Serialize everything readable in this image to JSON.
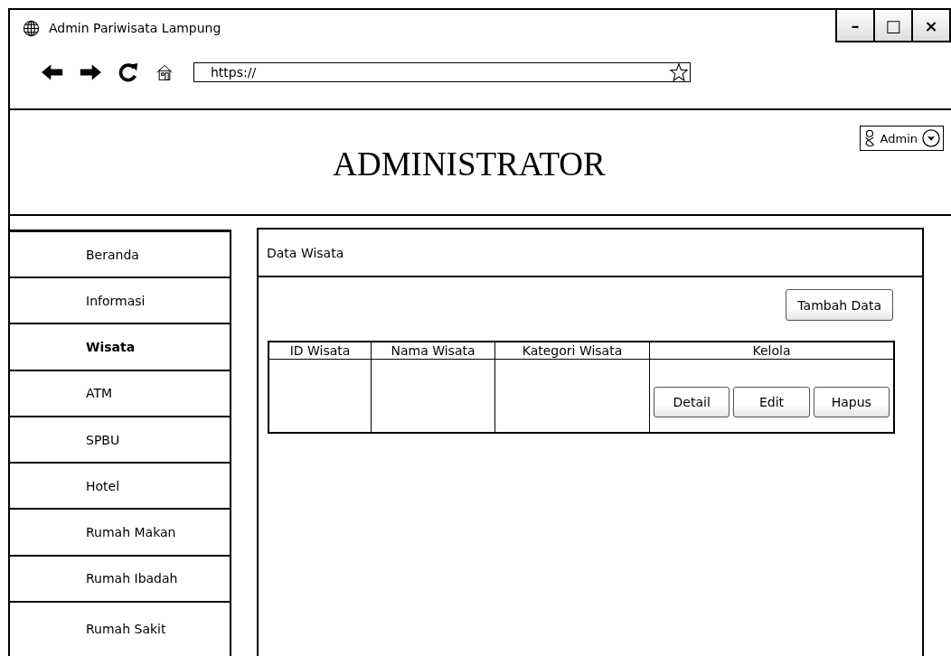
{
  "window": {
    "title": "Admin Pariwisata Lampung",
    "controls": [
      "–",
      "□",
      "×"
    ]
  },
  "browser": {
    "url": "https://"
  },
  "header": {
    "title": "ADMINISTRATOR",
    "user": "Admin"
  },
  "sidebar": {
    "items": [
      {
        "label": "Beranda",
        "selected": false
      },
      {
        "label": "Informasi",
        "selected": false
      },
      {
        "label": "Wisata",
        "selected": true
      },
      {
        "label": "ATM",
        "selected": false
      },
      {
        "label": "SPBU",
        "selected": false
      },
      {
        "label": "Hotel",
        "selected": false
      },
      {
        "label": "Rumah Makan",
        "selected": false
      },
      {
        "label": "Rumah Ibadah",
        "selected": false
      },
      {
        "label": "Rumah Sakit",
        "selected": false
      }
    ]
  },
  "panel": {
    "title": "Data Wisata",
    "add_button": "Tambah Data",
    "table": {
      "columns": [
        "ID Wisata",
        "Nama Wisata",
        "Kategori Wisata",
        "Kelola"
      ],
      "rows": [
        {
          "actions": [
            "Detail",
            "Edit",
            "Hapus"
          ]
        }
      ]
    }
  }
}
